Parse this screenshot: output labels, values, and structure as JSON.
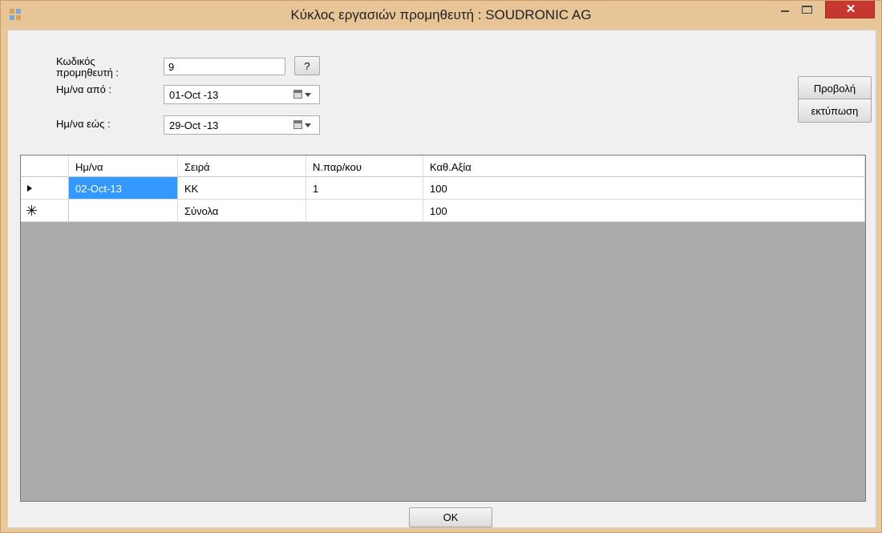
{
  "window": {
    "title": "Κύκλος εργασιών προμηθευτή : SOUDRONIC AG",
    "close_glyph": "✕"
  },
  "form": {
    "supplier_code_label_line1": "Κωδικός",
    "supplier_code_label_line2": "προμηθευτή :",
    "supplier_code_value": "9",
    "lookup_button_label": "?",
    "date_from_label": "Ημ/να από :",
    "date_from_value": "01-Oct -13",
    "date_to_label": "Ημ/να εώς :",
    "date_to_value": "29-Oct -13",
    "view_button_label": "Προβολή",
    "print_button_label": "εκτύπωση",
    "ok_button_label": "OK"
  },
  "grid": {
    "columns": [
      "Ημ/να",
      "Σειρά",
      "Ν.παρ/κου",
      "Καθ.Αξία"
    ],
    "rows": [
      {
        "indicator": "current",
        "cells": [
          "02-Oct-13",
          "KK",
          "1",
          "100"
        ]
      },
      {
        "indicator": "new",
        "cells": [
          "",
          "Σύνολα",
          "",
          "100"
        ]
      }
    ],
    "new_row_glyph": "✳"
  },
  "colors": {
    "title_bar": "#e7c597",
    "close_button": "#c7372f",
    "selected_cell": "#3399ff",
    "grid_background": "#ababab"
  }
}
